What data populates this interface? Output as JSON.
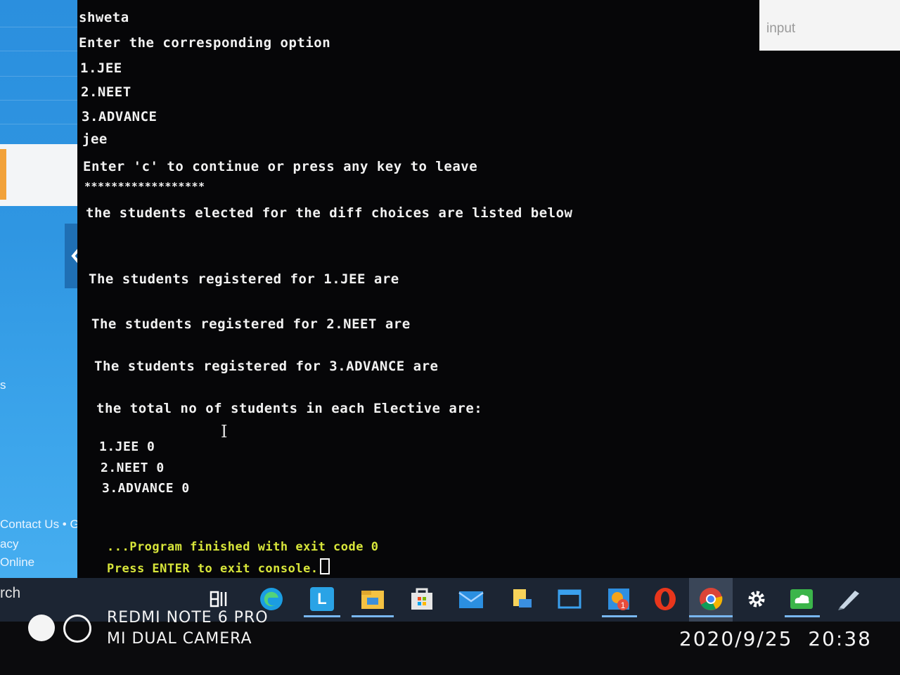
{
  "sidebar": {
    "footer_links": "Contact Us • GDB",
    "footer_line2": "acy",
    "footer_line3": "Online",
    "mid_text": "s",
    "search_partial": "rch"
  },
  "input_panel": {
    "label": "input"
  },
  "console": {
    "lines": [
      "shweta",
      "Enter the corresponding option",
      "1.JEE",
      "2.NEET",
      "3.ADVANCE",
      "jee",
      "Enter 'c' to continue or press any key to leave",
      "******************",
      "the students elected for the diff choices are listed below",
      "The students registered for 1.JEE are",
      "The students registered for 2.NEET are",
      "The students registered for 3.ADVANCE are",
      "the total no of students in each Elective are:",
      "1.JEE 0",
      "2.NEET 0",
      "3.ADVANCE 0"
    ],
    "finished": "...Program finished with exit code 0",
    "press_enter": "Press ENTER to exit console."
  },
  "taskbar": {
    "icons": [
      "task-view-icon",
      "edge-icon",
      "l-app-icon",
      "file-explorer-icon",
      "store-icon",
      "mail-icon",
      "sticky-notes-icon",
      "window-app-icon",
      "photos-icon",
      "opera-icon",
      "chrome-icon",
      "settings-icon",
      "cloud-icon",
      "pen-icon"
    ],
    "colors": {
      "edge": "#1b9de2",
      "l_app": "#2aa3e6",
      "explorer": "#f5c242",
      "opera": "#e8361c",
      "chrome_red": "#db4437",
      "chrome_yellow": "#f4b400",
      "chrome_green": "#0f9d58",
      "cloud": "#3bb54a"
    }
  },
  "watermark": {
    "device": "REDMI NOTE 6 PRO",
    "camera": "MI DUAL CAMERA",
    "date": "2020/9/25",
    "time": "20:38"
  }
}
